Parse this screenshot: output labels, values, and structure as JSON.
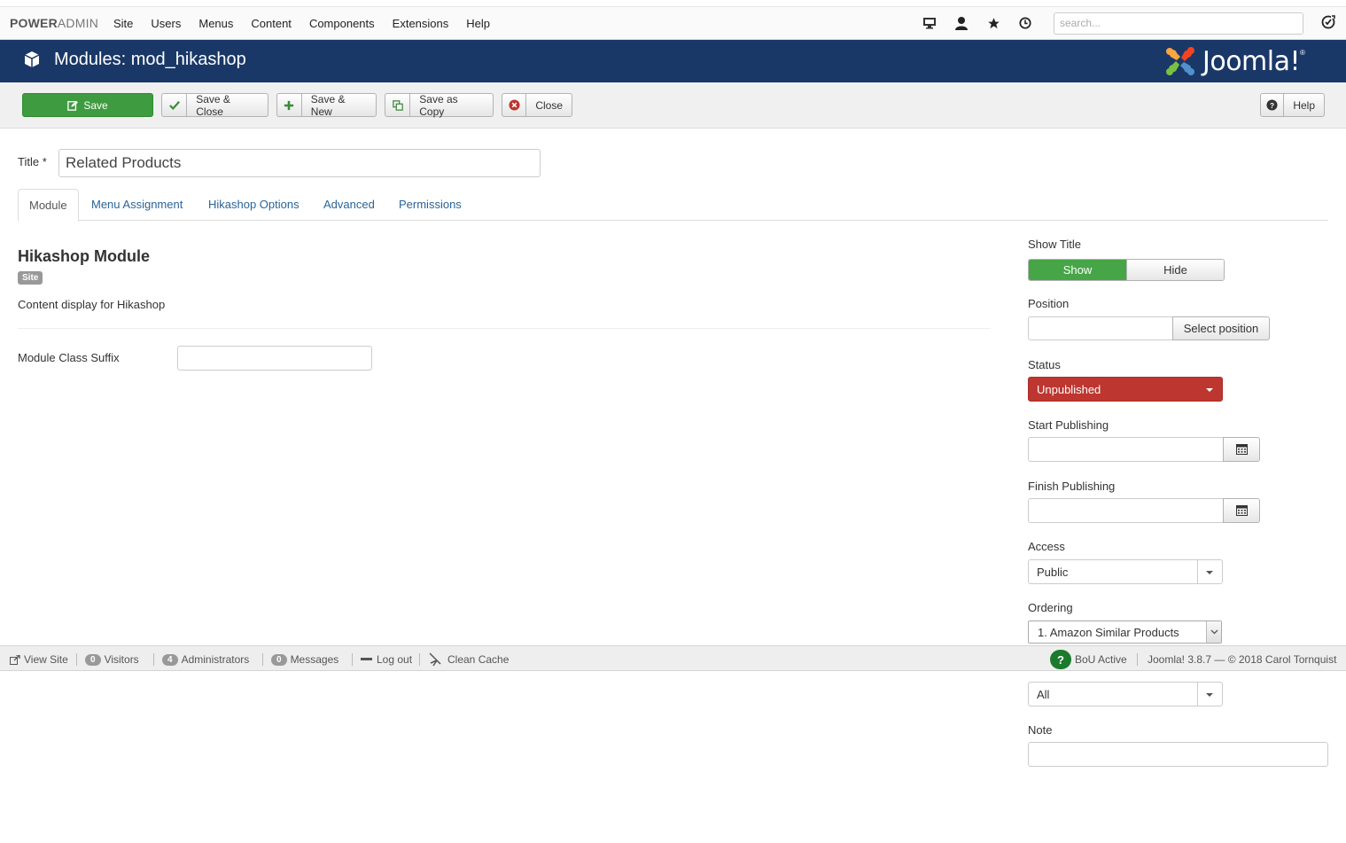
{
  "topbar": {
    "brand_power": "POWER",
    "brand_admin": "ADMIN",
    "menu": [
      "Site",
      "Users",
      "Menus",
      "Content",
      "Components",
      "Extensions",
      "Help"
    ],
    "search_placeholder": "search..."
  },
  "header": {
    "title": "Modules: mod_hikashop",
    "logo_text": "Joomla!",
    "logo_reg": "®"
  },
  "toolbar": {
    "save": "Save",
    "save_close": "Save & Close",
    "save_new": "Save & New",
    "save_copy": "Save as Copy",
    "close": "Close",
    "help": "Help"
  },
  "form": {
    "title_label": "Title *",
    "title_value": "Related Products",
    "tabs": [
      "Module",
      "Menu Assignment",
      "Hikashop Options",
      "Advanced",
      "Permissions"
    ],
    "module_heading": "Hikashop Module",
    "site_badge": "Site",
    "description": "Content display for Hikashop",
    "class_suffix_label": "Module Class Suffix",
    "class_suffix_value": ""
  },
  "sidebar": {
    "show_title_label": "Show Title",
    "show_label": "Show",
    "hide_label": "Hide",
    "position_label": "Position",
    "select_position": "Select position",
    "status_label": "Status",
    "status_value": "Unpublished",
    "start_publishing_label": "Start Publishing",
    "finish_publishing_label": "Finish Publishing",
    "access_label": "Access",
    "access_value": "Public",
    "ordering_label": "Ordering",
    "ordering_value": "1. Amazon Similar Products",
    "language_value": "All",
    "note_label": "Note"
  },
  "statusbar": {
    "view_site": "View Site",
    "visitors_count": "0",
    "visitors": "Visitors",
    "admins_count": "4",
    "admins": "Administrators",
    "messages_count": "0",
    "messages": "Messages",
    "logout": "Log out",
    "clean_cache": "Clean Cache",
    "bou": "BoU Active",
    "copyright": "Joomla! 3.8.7  —  © 2018 Carol Tornquist"
  },
  "colors": {
    "header_bg": "#1a3867",
    "save_green": "#3f9b3f",
    "show_green": "#46a546",
    "status_red": "#bd362f",
    "link_blue": "#2a6496"
  }
}
